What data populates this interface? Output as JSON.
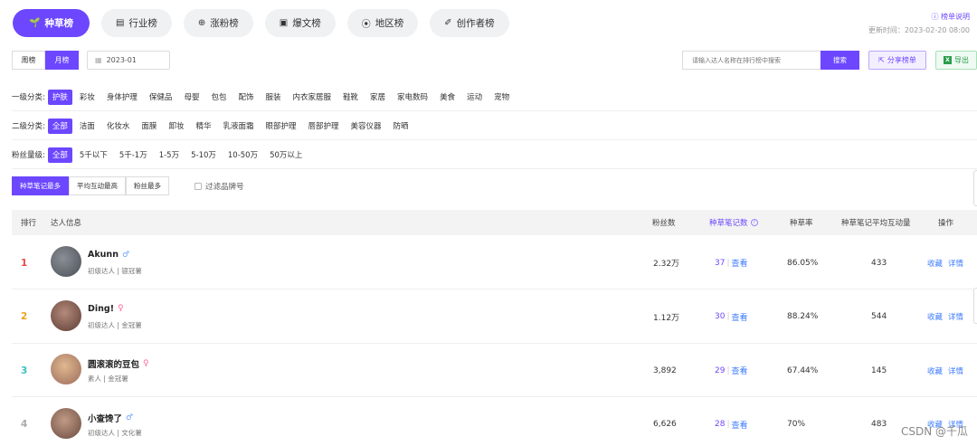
{
  "top_tabs": [
    {
      "icon": "🌱",
      "label": "种草榜",
      "active": true
    },
    {
      "icon": "▤",
      "label": "行业榜"
    },
    {
      "icon": "⊕",
      "label": "涨粉榜"
    },
    {
      "icon": "▣",
      "label": "爆文榜"
    },
    {
      "icon": "⦿",
      "label": "地区榜"
    },
    {
      "icon": "✐",
      "label": "创作者榜"
    }
  ],
  "rank_help": "ⓘ 榜单说明",
  "update_time": "更新时间：2023-02-20 08:00",
  "period": {
    "week": "周榜",
    "month": "月榜"
  },
  "date_value": "2023-01",
  "search": {
    "placeholder": "请输入达人名称在排行榜中搜索",
    "button": "搜索"
  },
  "share_label": "分享榜单",
  "export_label": "导出",
  "filters": {
    "level1": {
      "label": "一级分类:",
      "options": [
        "护肤",
        "彩妆",
        "身体护理",
        "保健品",
        "母婴",
        "包包",
        "配饰",
        "服装",
        "内衣家居服",
        "鞋靴",
        "家居",
        "家电数码",
        "美食",
        "运动",
        "宠物"
      ]
    },
    "level2": {
      "label": "二级分类:",
      "options": [
        "全部",
        "洁面",
        "化妆水",
        "面膜",
        "卸妆",
        "精华",
        "乳液面霜",
        "眼部护理",
        "唇部护理",
        "美容仪器",
        "防晒"
      ]
    },
    "fans": {
      "label": "粉丝量级:",
      "options": [
        "全部",
        "5千以下",
        "5千-1万",
        "1-5万",
        "5-10万",
        "10-50万",
        "50万以上"
      ]
    }
  },
  "sort_tabs": [
    "种草笔记最多",
    "平均互动最高",
    "粉丝最多"
  ],
  "filter_brand": "过滤品牌号",
  "table": {
    "headers": {
      "rank": "排行",
      "info": "达人信息",
      "fans": "粉丝数",
      "notes": "种草笔记数",
      "rate": "种草率",
      "avg": "种草笔记平均互动量",
      "ops": "操作"
    },
    "view_label": "查看",
    "fav_label": "收藏",
    "detail_label": "详情",
    "rows": [
      {
        "rank": "1",
        "rank_color": "#e84a4a",
        "name": "Akunn",
        "gender": "♂",
        "tags": "初级达人 | 银冠薯",
        "fans": "2.32万",
        "notes": "37",
        "rate": "86.05%",
        "avg": "433"
      },
      {
        "rank": "2",
        "rank_color": "#f0a020",
        "name": "Ding!",
        "gender": "♀",
        "tags": "初级达人 | 金冠薯",
        "fans": "1.12万",
        "notes": "30",
        "rate": "88.24%",
        "avg": "544"
      },
      {
        "rank": "3",
        "rank_color": "#3cc0c0",
        "name": "圆滚滚的豆包",
        "gender": "♀",
        "tags": "素人 | 金冠薯",
        "fans": "3,892",
        "notes": "29",
        "rate": "67.44%",
        "avg": "145"
      },
      {
        "rank": "4",
        "rank_color": "#aaaaaa",
        "name": "小查馋了",
        "gender": "♂",
        "tags": "初级达人 | 文化薯",
        "fans": "6,626",
        "notes": "28",
        "rate": "70%",
        "avg": "483"
      }
    ]
  },
  "watermark": "CSDN @千瓜",
  "colors": {
    "accent": "#6c47ff",
    "link": "#3d7bff"
  }
}
